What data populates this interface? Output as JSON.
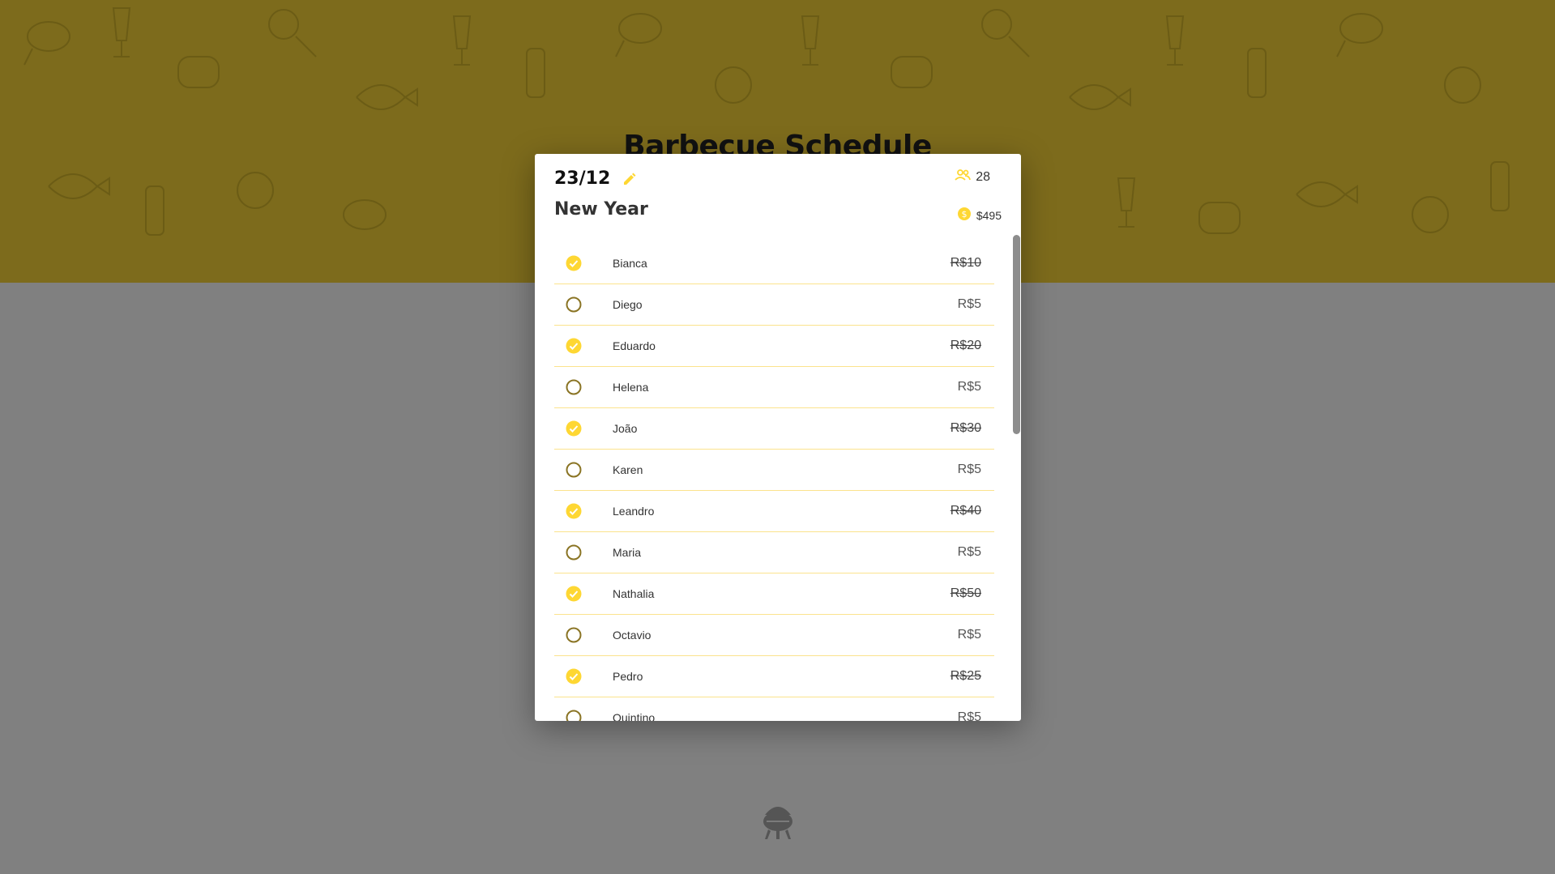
{
  "page": {
    "title": "Barbecue Schedule",
    "colors": {
      "accent": "#fed733",
      "header": "#7d6b1c",
      "overlay": "#808080"
    }
  },
  "event": {
    "date": "23/12",
    "name": "New Year",
    "participants_count": "28",
    "total_amount": "$495",
    "icons": {
      "edit": "pencil-icon",
      "people": "people-icon",
      "money": "coin-icon"
    }
  },
  "participants": [
    {
      "name": "Bianca",
      "value": "R$10",
      "paid": true
    },
    {
      "name": "Diego",
      "value": "R$5",
      "paid": false
    },
    {
      "name": "Eduardo",
      "value": "R$20",
      "paid": true
    },
    {
      "name": "Helena",
      "value": "R$5",
      "paid": false
    },
    {
      "name": "João",
      "value": "R$30",
      "paid": true
    },
    {
      "name": "Karen",
      "value": "R$5",
      "paid": false
    },
    {
      "name": "Leandro",
      "value": "R$40",
      "paid": true
    },
    {
      "name": "Maria",
      "value": "R$5",
      "paid": false
    },
    {
      "name": "Nathalia",
      "value": "R$50",
      "paid": true
    },
    {
      "name": "Octavio",
      "value": "R$5",
      "paid": false
    },
    {
      "name": "Pedro",
      "value": "R$25",
      "paid": true
    },
    {
      "name": "Quintino",
      "value": "R$5",
      "paid": false
    }
  ]
}
